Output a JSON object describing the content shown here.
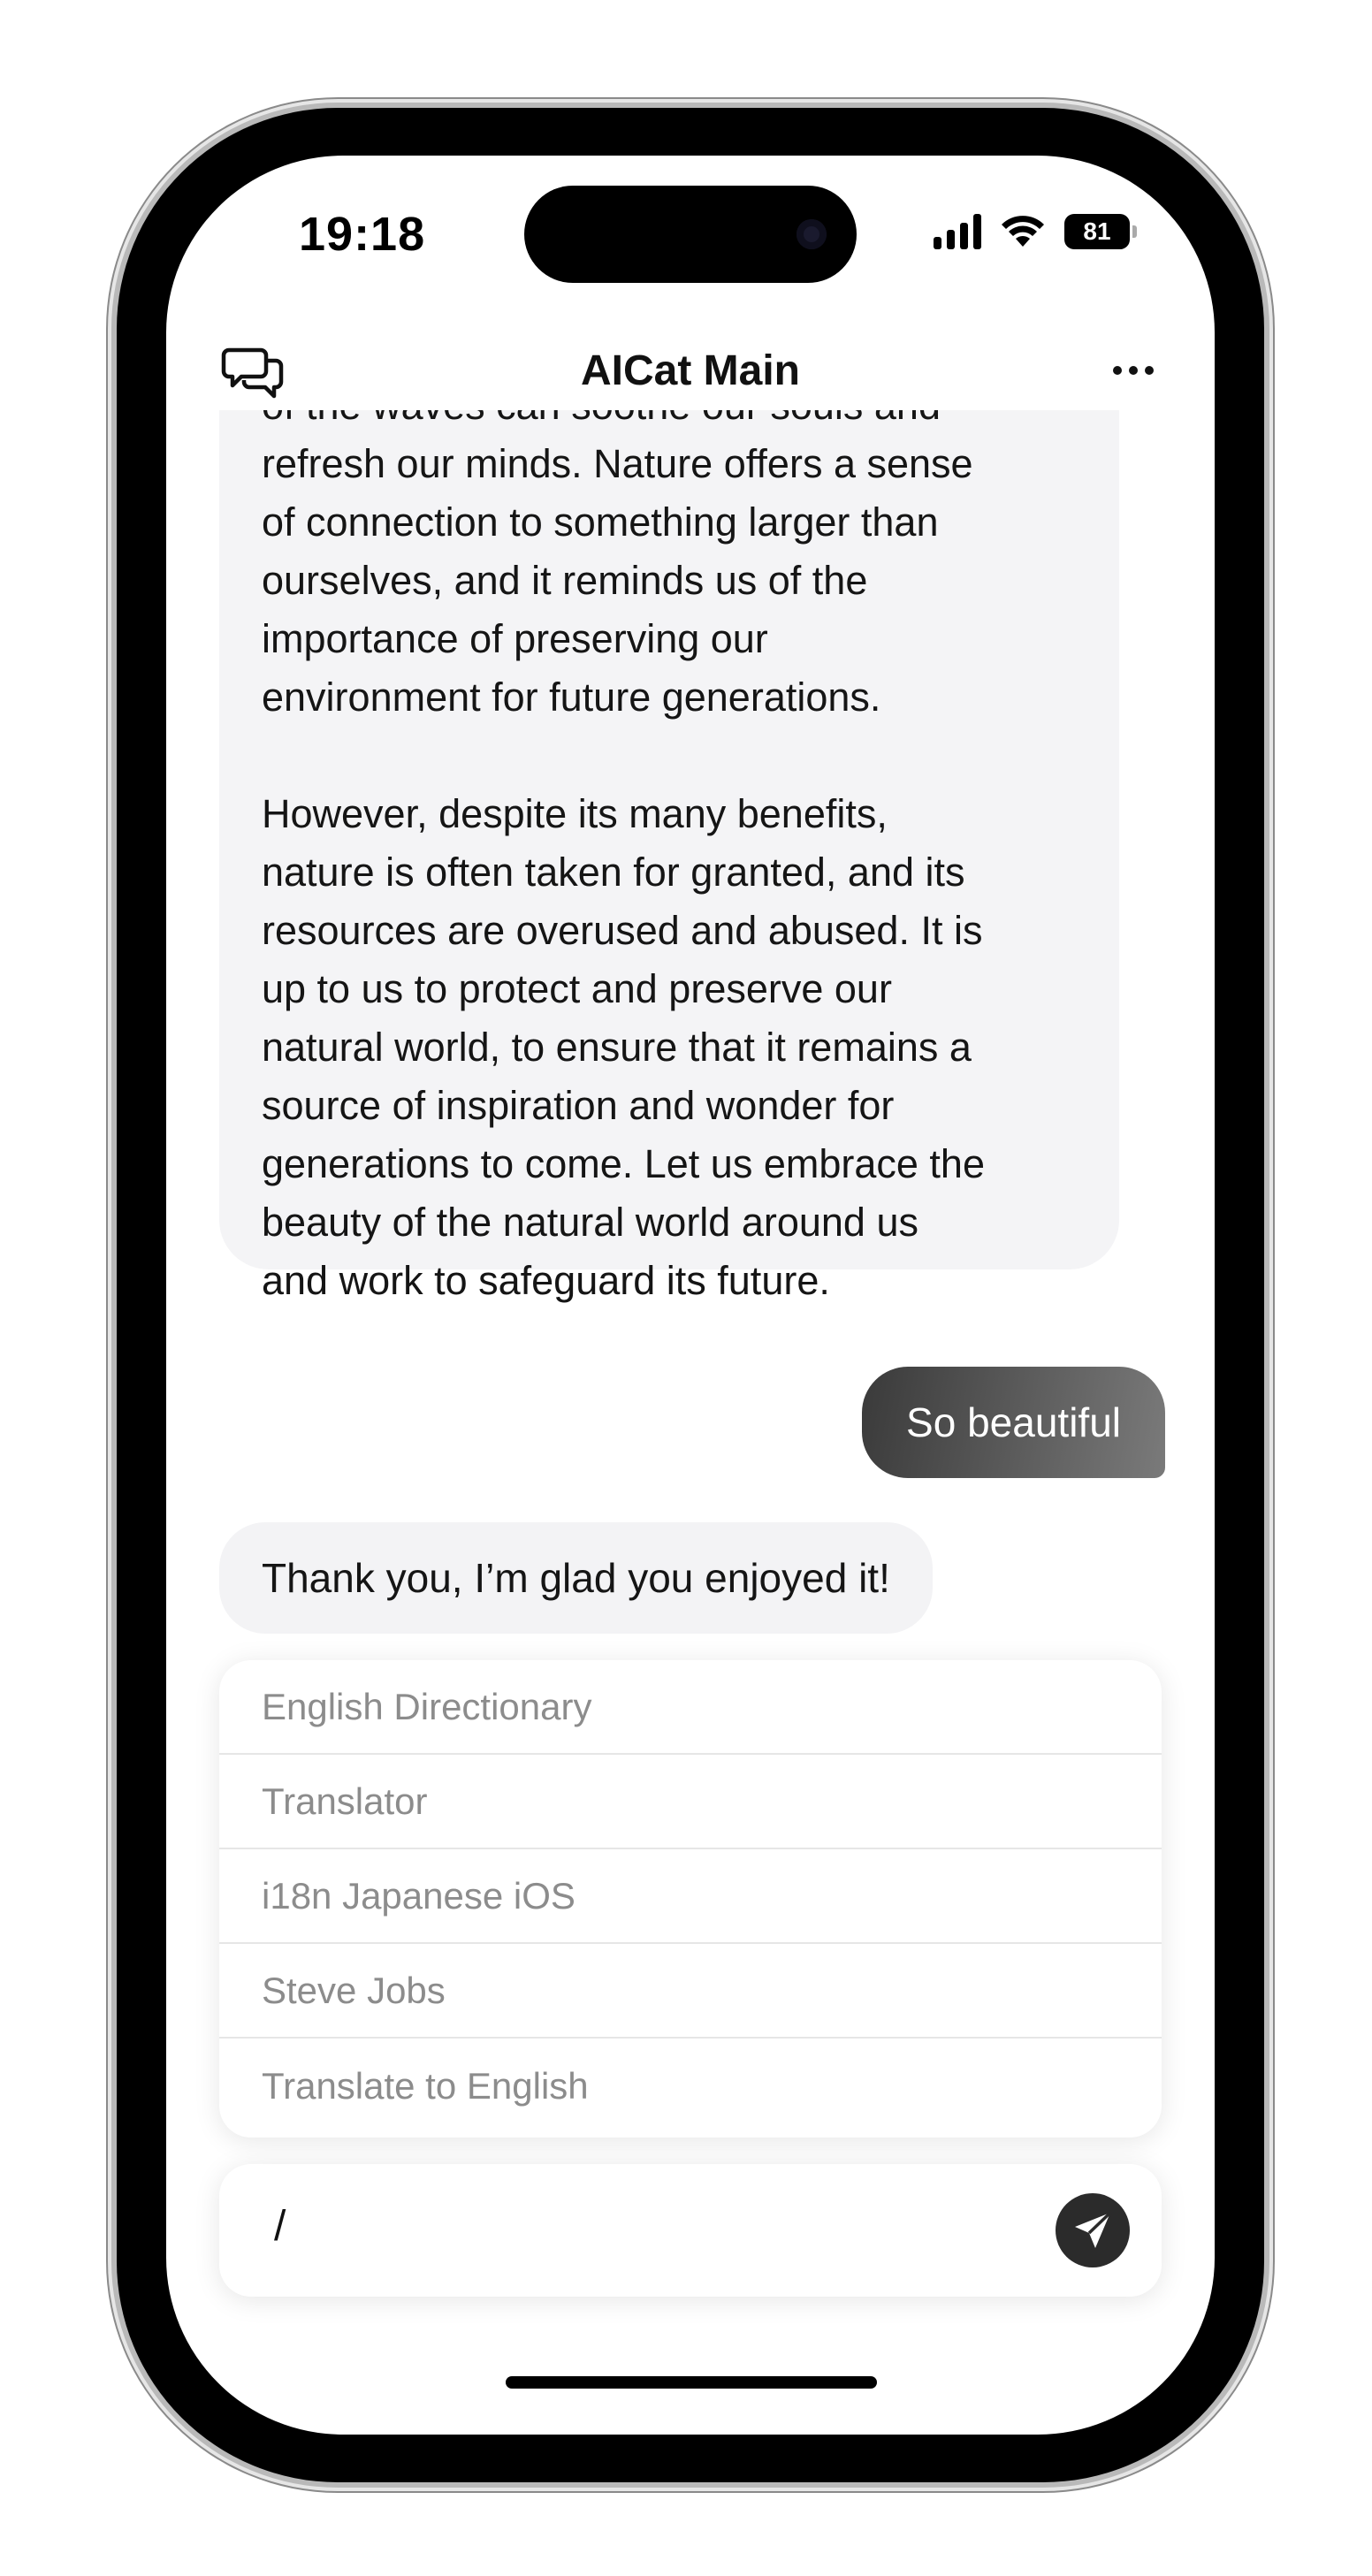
{
  "status_bar": {
    "time": "19:18",
    "battery": "81"
  },
  "header": {
    "title": "AICat Main"
  },
  "messages": {
    "ai_long": "of the waves can soothe our souls and\nrefresh our minds. Nature offers a sense\nof connection to something larger than\nourselves, and it reminds us of the\nimportance of preserving our\nenvironment for future generations.\n\nHowever, despite its many benefits,\nnature is often taken for granted, and its\nresources are overused and abused. It is\nup to us to protect and preserve our\nnatural world, to ensure that it remains a\nsource of inspiration and wonder for\ngenerations to come. Let us embrace the\nbeauty of the natural world around us\nand work to safeguard its future.",
    "user": "So beautiful",
    "ai_short": "Thank you, I’m glad you enjoyed it!"
  },
  "suggestions": [
    {
      "label": "English Directionary"
    },
    {
      "label": "Translator"
    },
    {
      "label": "i18n Japanese iOS"
    },
    {
      "label": "Steve Jobs"
    },
    {
      "label": "Translate to English"
    }
  ],
  "input": {
    "value": "/"
  },
  "icons": {
    "left": "chat-bubbles-icon",
    "right": "more-icon",
    "send": "send-icon"
  }
}
